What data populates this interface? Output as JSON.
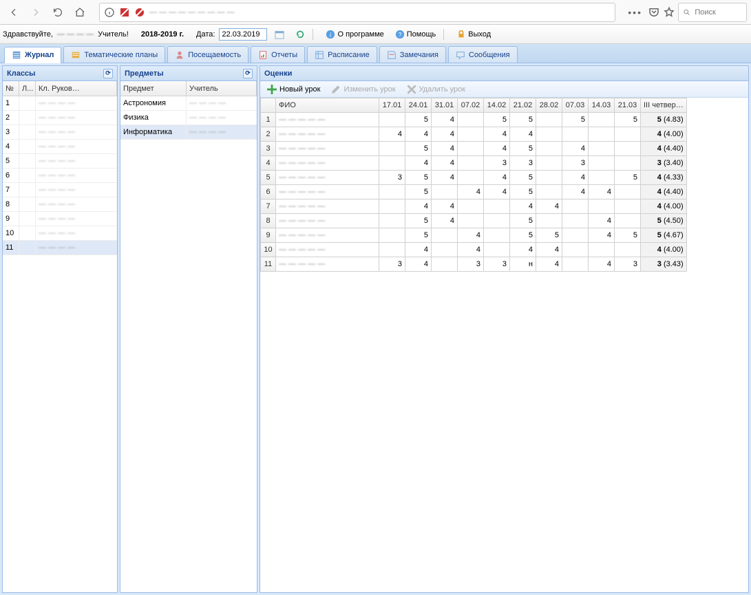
{
  "browser": {
    "search_placeholder": "Поиск",
    "menu_dots": "•••"
  },
  "header": {
    "greeting": "Здравствуйте,",
    "role_suffix": "Учитель!",
    "year": "2018-2019 г.",
    "date_label": "Дата:",
    "date_value": "22.03.2019",
    "about": "О программе",
    "help": "Помощь",
    "exit": "Выход"
  },
  "tabs": [
    {
      "label": "Журнал",
      "active": true
    },
    {
      "label": "Тематические планы",
      "active": false
    },
    {
      "label": "Посещаемость",
      "active": false
    },
    {
      "label": "Отчеты",
      "active": false
    },
    {
      "label": "Расписание",
      "active": false
    },
    {
      "label": "Замечания",
      "active": false
    },
    {
      "label": "Сообщения",
      "active": false
    }
  ],
  "classes_panel": {
    "title": "Классы",
    "columns": {
      "num": "№",
      "l": "Л...",
      "ruk": "Кл. Руков…"
    },
    "rows": [
      {
        "num": "1"
      },
      {
        "num": "2"
      },
      {
        "num": "3"
      },
      {
        "num": "4"
      },
      {
        "num": "5"
      },
      {
        "num": "6"
      },
      {
        "num": "7"
      },
      {
        "num": "8"
      },
      {
        "num": "9"
      },
      {
        "num": "10"
      },
      {
        "num": "11",
        "selected": true
      }
    ]
  },
  "subjects_panel": {
    "title": "Предметы",
    "columns": {
      "subj": "Предмет",
      "teach": "Учитель"
    },
    "rows": [
      {
        "subj": "Астрономия"
      },
      {
        "subj": "Физика"
      },
      {
        "subj": "Информатика",
        "selected": true
      }
    ]
  },
  "grades_panel": {
    "title": "Оценки",
    "toolbar": {
      "new": "Новый урок",
      "edit": "Изменить урок",
      "del": "Удалить урок"
    },
    "columns": {
      "fio": "ФИО",
      "dates": [
        "17.01",
        "24.01",
        "31.01",
        "07.02",
        "14.02",
        "21.02",
        "28.02",
        "07.03",
        "14.03",
        "21.03"
      ],
      "quarter": "III четвер…"
    },
    "rows": [
      {
        "n": 1,
        "g": [
          "",
          "5",
          "4",
          "",
          "5",
          "5",
          "",
          "5",
          "",
          "5"
        ],
        "qg": "5",
        "qa": "(4.83)"
      },
      {
        "n": 2,
        "g": [
          "4",
          "4",
          "4",
          "",
          "4",
          "4",
          "",
          "",
          "",
          ""
        ],
        "qg": "4",
        "qa": "(4.00)"
      },
      {
        "n": 3,
        "g": [
          "",
          "5",
          "4",
          "",
          "4",
          "5",
          "",
          "4",
          "",
          ""
        ],
        "qg": "4",
        "qa": "(4.40)"
      },
      {
        "n": 4,
        "g": [
          "",
          "4",
          "4",
          "",
          "3",
          "3",
          "",
          "3",
          "",
          ""
        ],
        "qg": "3",
        "qa": "(3.40)"
      },
      {
        "n": 5,
        "g": [
          "3",
          "5",
          "4",
          "",
          "4",
          "5",
          "",
          "4",
          "",
          "5"
        ],
        "qg": "4",
        "qa": "(4.33)"
      },
      {
        "n": 6,
        "g": [
          "",
          "5",
          "",
          "4",
          "4",
          "5",
          "",
          "4",
          "4",
          ""
        ],
        "qg": "4",
        "qa": "(4.40)"
      },
      {
        "n": 7,
        "g": [
          "",
          "4",
          "4",
          "",
          "",
          "4",
          "4",
          "",
          "",
          ""
        ],
        "qg": "4",
        "qa": "(4.00)"
      },
      {
        "n": 8,
        "g": [
          "",
          "5",
          "4",
          "",
          "",
          "5",
          "",
          "",
          "4",
          ""
        ],
        "qg": "5",
        "qa": "(4.50)"
      },
      {
        "n": 9,
        "g": [
          "",
          "5",
          "",
          "4",
          "",
          "5",
          "5",
          "",
          "4",
          "5"
        ],
        "qg": "5",
        "qa": "(4.67)"
      },
      {
        "n": 10,
        "g": [
          "",
          "4",
          "",
          "4",
          "",
          "4",
          "4",
          "",
          "",
          ""
        ],
        "qg": "4",
        "qa": "(4.00)"
      },
      {
        "n": 11,
        "g": [
          "3",
          "4",
          "",
          "3",
          "3",
          "н",
          "4",
          "",
          "4",
          "3"
        ],
        "qg": "3",
        "qa": "(3.43)"
      }
    ]
  }
}
